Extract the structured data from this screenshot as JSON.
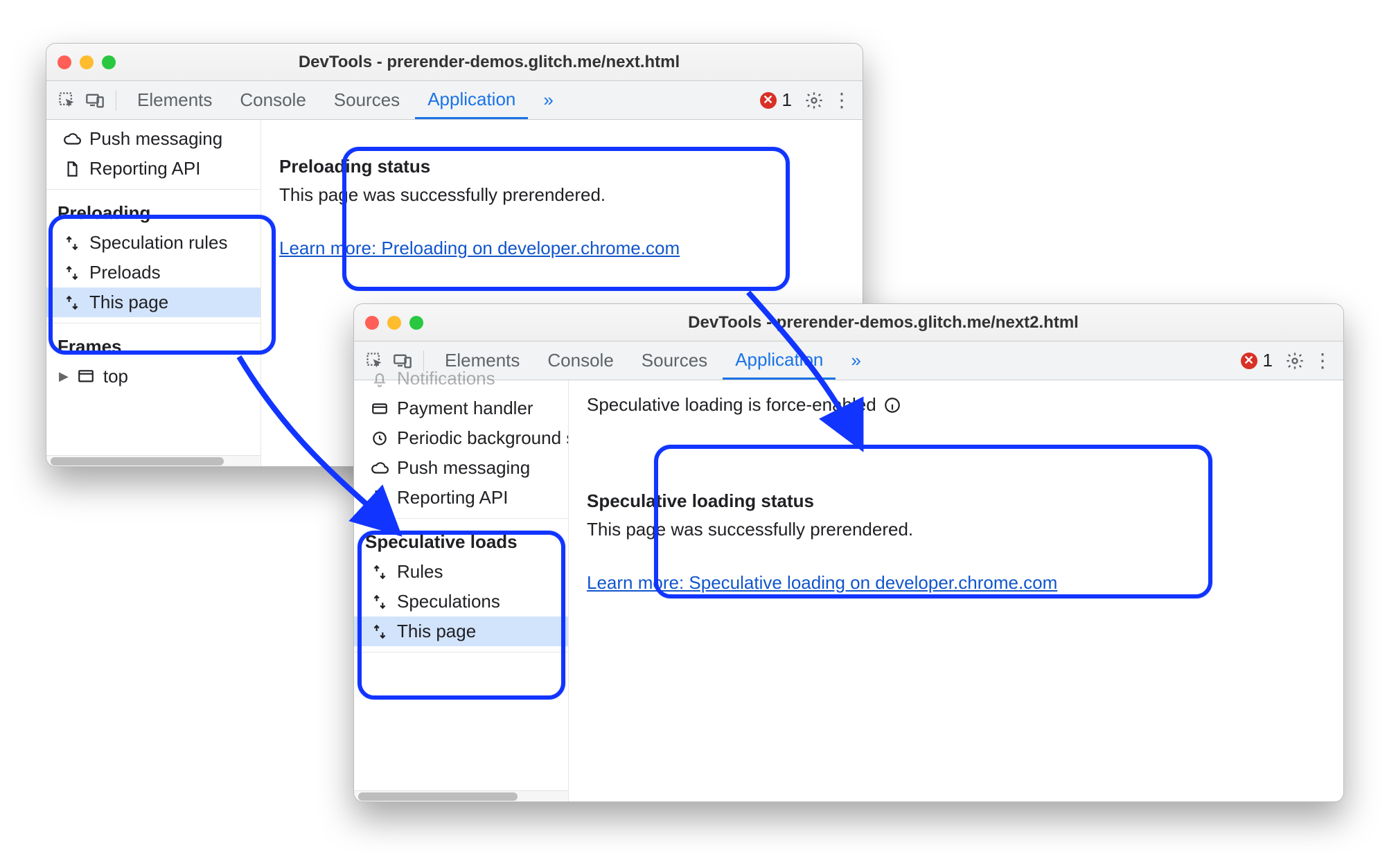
{
  "highlight_color": "#1135ff",
  "win1": {
    "title": "DevTools - prerender-demos.glitch.me/next.html",
    "tabs": [
      "Elements",
      "Console",
      "Sources",
      "Application"
    ],
    "active_tab_index": 3,
    "more_glyph": "»",
    "error_count": "1",
    "sidebar_top": [
      {
        "icon": "cloud",
        "label": "Push messaging"
      },
      {
        "icon": "file",
        "label": "Reporting API"
      }
    ],
    "category1": "Preloading",
    "category1_items": [
      {
        "icon": "updown",
        "label": "Speculation rules"
      },
      {
        "icon": "updown",
        "label": "Preloads"
      },
      {
        "icon": "updown",
        "label": "This page",
        "selected": true
      }
    ],
    "category2": "Frames",
    "category2_items": [
      {
        "icon": "frame",
        "label": "top",
        "expander": true
      }
    ],
    "panel": {
      "title": "Preloading status",
      "body": "This page was successfully prerendered.",
      "link": "Learn more: Preloading on developer.chrome.com"
    }
  },
  "win2": {
    "title": "DevTools - prerender-demos.glitch.me/next2.html",
    "tabs": [
      "Elements",
      "Console",
      "Sources",
      "Application"
    ],
    "active_tab_index": 3,
    "more_glyph": "»",
    "error_count": "1",
    "sidebar_top": [
      {
        "icon": "bell",
        "label": "Notifications",
        "truncated": true
      },
      {
        "icon": "card",
        "label": "Payment handler"
      },
      {
        "icon": "clock",
        "label": "Periodic background sy",
        "truncated": true
      },
      {
        "icon": "cloud",
        "label": "Push messaging"
      },
      {
        "icon": "file",
        "label": "Reporting API"
      }
    ],
    "category1": "Speculative loads",
    "category1_items": [
      {
        "icon": "updown",
        "label": "Rules"
      },
      {
        "icon": "updown",
        "label": "Speculations"
      },
      {
        "icon": "updown",
        "label": "This page",
        "selected": true
      }
    ],
    "notice": "Speculative loading is force-enabled",
    "panel": {
      "title": "Speculative loading status",
      "body": "This page was successfully prerendered.",
      "link": "Learn more: Speculative loading on developer.chrome.com"
    }
  }
}
